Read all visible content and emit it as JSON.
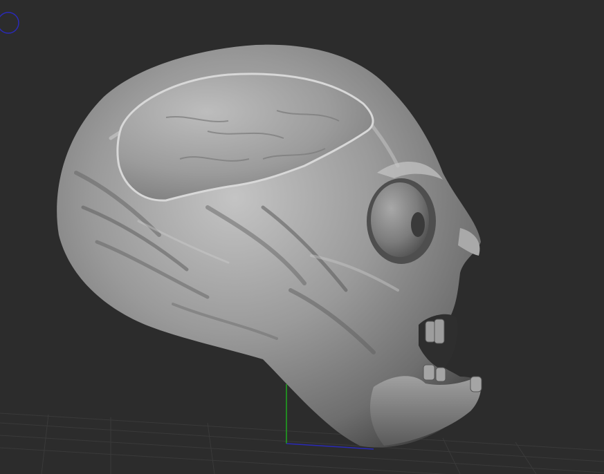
{
  "viewport": {
    "background": "#2c2c2c",
    "grid_color": "#3a3a3a",
    "axis_x_color": "#2a2ab8",
    "axis_y_color": "#1fa81f",
    "gizmo_color": "#2a2ab8",
    "model_base_color": "#8f8f8f",
    "model_highlight_color": "#d0d0d0",
    "model_shadow_color": "#3d3d3d",
    "model": "sculpted-alien-skull",
    "gizmo_icon": "rotation-gizmo-icon"
  }
}
